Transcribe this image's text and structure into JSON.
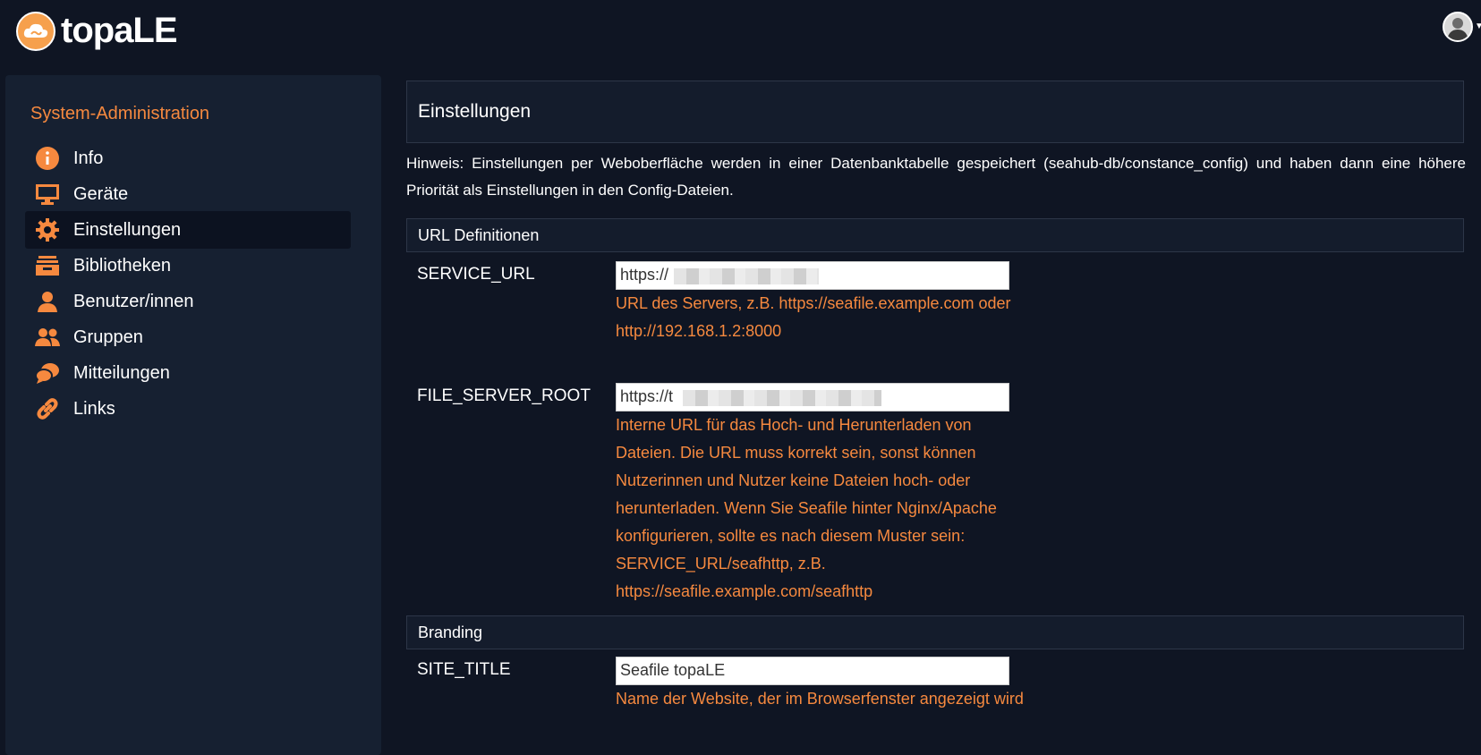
{
  "header": {
    "brand": "topaLE",
    "colors": {
      "accent": "#f6893f",
      "background": "#0f1523",
      "panel": "#162031"
    }
  },
  "sidebar": {
    "title": "System-Administration",
    "items": [
      {
        "label": "Info",
        "icon": "info-icon"
      },
      {
        "label": "Geräte",
        "icon": "monitor-icon"
      },
      {
        "label": "Einstellungen",
        "icon": "gear-icon",
        "active": true
      },
      {
        "label": "Bibliotheken",
        "icon": "library-icon"
      },
      {
        "label": "Benutzer/innen",
        "icon": "user-icon"
      },
      {
        "label": "Gruppen",
        "icon": "group-icon"
      },
      {
        "label": "Mitteilungen",
        "icon": "chat-icon"
      },
      {
        "label": "Links",
        "icon": "link-icon"
      }
    ]
  },
  "main": {
    "title": "Einstellungen",
    "hint": "Hinweis: Einstellungen per Weboberfläche werden in einer Datenbanktabelle gespeichert (seahub-db/constance_config) und haben dann eine höhere Priorität als Einstellungen in den Config-Dateien.",
    "sections": [
      {
        "title": "URL Definitionen",
        "fields": [
          {
            "label": "SERVICE_URL",
            "value": "https://",
            "help": "URL des Servers, z.B. https://seafile.example.com oder http://192.168.1.2:8000"
          },
          {
            "label": "FILE_SERVER_ROOT",
            "value": "https://t",
            "help": "Interne URL für das Hoch- und Herunterladen von Dateien. Die URL muss korrekt sein, sonst können Nutzerinnen und Nutzer keine Dateien hoch- oder herunterladen. Wenn Sie Seafile hinter Nginx/Apache konfigurieren, sollte es nach diesem Muster sein: SERVICE_URL/seafhttp, z.B. https://seafile.example.com/seafhttp"
          }
        ]
      },
      {
        "title": "Branding",
        "fields": [
          {
            "label": "SITE_TITLE",
            "value": "Seafile topaLE",
            "help": "Name der Website, der im Browserfenster angezeigt wird"
          }
        ]
      }
    ]
  }
}
